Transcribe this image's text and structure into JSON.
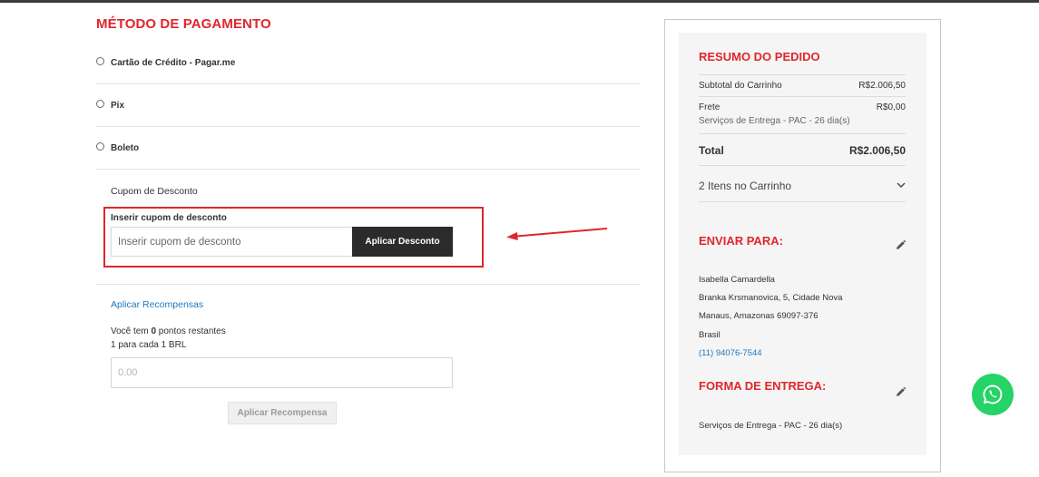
{
  "payment": {
    "title": "MÉTODO DE PAGAMENTO",
    "options": [
      {
        "label": "Cartão de Crédito - Pagar.me"
      },
      {
        "label": "Pix"
      },
      {
        "label": "Boleto"
      }
    ]
  },
  "coupon": {
    "heading": "Cupom de Desconto",
    "field_label": "Inserir cupom de desconto",
    "placeholder": "Inserir cupom de desconto",
    "button": "Aplicar Desconto"
  },
  "rewards": {
    "link": "Aplicar Recompensas",
    "points_prefix": "Você tem ",
    "points": "0",
    "points_suffix": " pontos restantes",
    "rate": "1 para cada 1 BRL",
    "placeholder": "0.00",
    "button": "Aplicar Recompensa"
  },
  "summary": {
    "title": "RESUMO DO PEDIDO",
    "subtotal_label": "Subtotal do Carrinho",
    "subtotal_value": "R$2.006,50",
    "shipping_label": "Frete",
    "shipping_value": "R$0,00",
    "shipping_service": "Serviços de Entrega - PAC - 26 dia(s)",
    "total_label": "Total",
    "total_value": "R$2.006,50",
    "items": "2 Itens no Carrinho"
  },
  "ship_to": {
    "title": "ENVIAR PARA:",
    "name": "Isabella Camardella",
    "street": "Branka Krsmanovica, 5, Cidade Nova",
    "city": "Manaus, Amazonas 69097-376",
    "country": "Brasil",
    "phone": "(11) 94076-7544"
  },
  "delivery": {
    "title": "FORMA DE ENTREGA:",
    "method": "Serviços de Entrega - PAC - 26 dia(s)"
  },
  "colors": {
    "accent": "#e0262b",
    "link": "#1979c3",
    "whatsapp": "#25d366",
    "dark_button": "#2b2b2b"
  },
  "icons": [
    "pencil-icon",
    "chevron-down-icon",
    "whatsapp-icon",
    "arrow-icon"
  ]
}
